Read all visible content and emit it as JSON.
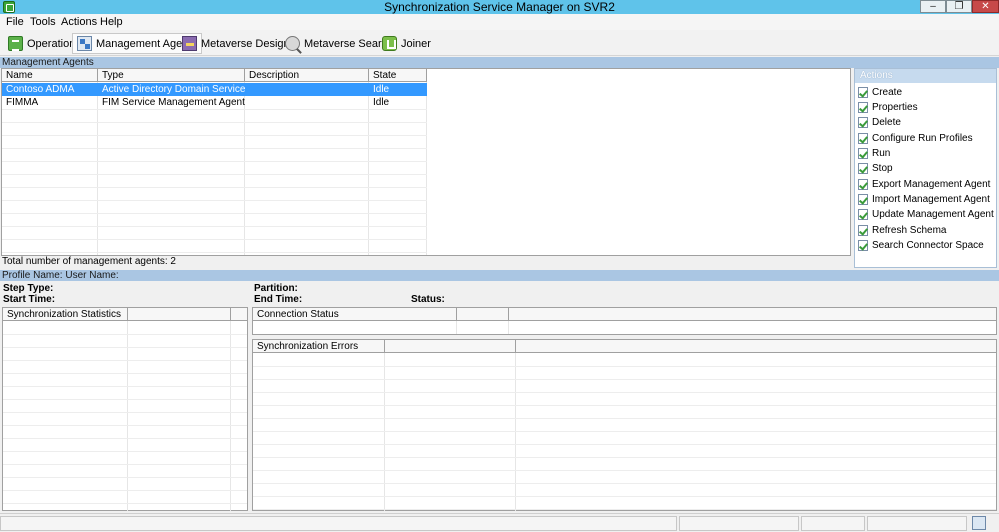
{
  "window": {
    "title": "Synchronization Service Manager on SVR2"
  },
  "menu": [
    "File",
    "Tools",
    "Actions",
    "Help"
  ],
  "toolbar": {
    "operations": "Operations",
    "management_agents": "Management Agents",
    "metaverse_designer": "Metaverse Designer",
    "metaverse_search": "Metaverse Search",
    "joiner": "Joiner"
  },
  "ma_panel": {
    "title": "Management Agents",
    "columns": [
      "Name",
      "Type",
      "Description",
      "State"
    ],
    "rows": [
      {
        "name": "Contoso ADMA",
        "type": "Active Directory Domain Services",
        "description": "",
        "state": "Idle",
        "selected": true
      },
      {
        "name": "FIMMA",
        "type": "FIM Service Management Agent",
        "description": "",
        "state": "Idle",
        "selected": false
      }
    ],
    "total": "Total number of management agents: 2"
  },
  "actions": {
    "title": "Actions",
    "items": [
      "Create",
      "Properties",
      "Delete",
      "Configure Run Profiles",
      "Run",
      "Stop",
      "Export Management Agent",
      "Import Management Agent",
      "Update Management Agent",
      "Refresh Schema",
      "Search Connector Space"
    ]
  },
  "profile": {
    "header": "Profile Name:   User Name:",
    "step_type": "Step Type:",
    "start_time": "Start Time:",
    "partition": "Partition:",
    "end_time": "End Time:",
    "status": "Status:"
  },
  "sync_stats": {
    "title": "Synchronization Statistics"
  },
  "connection_status": {
    "title": "Connection Status"
  },
  "sync_errors": {
    "title": "Synchronization Errors"
  },
  "colors": {
    "titlebar": "#5fc3ea",
    "section_bar": "#aac6e3",
    "selection": "#3399ff"
  }
}
